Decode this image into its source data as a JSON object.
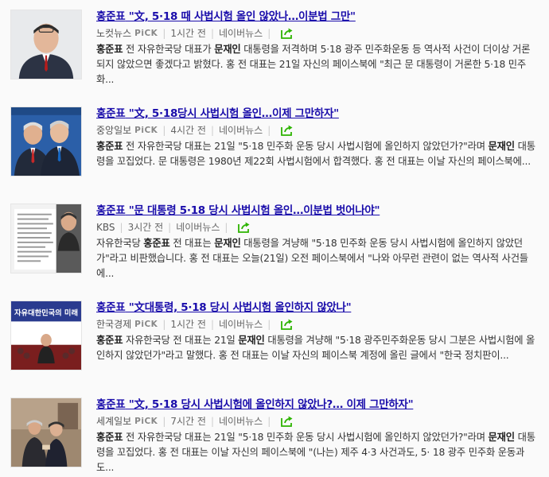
{
  "colors": {
    "link": "#1a0dab",
    "share_icon": "#2db400"
  },
  "results": [
    {
      "title_pre": "홍준표",
      "title_rest": " \"文, 5·18 때 사법시험 올인 않았나…이분법 그만\"",
      "source": "노컷뉴스",
      "pick": "PiCK",
      "time": "1시간 전",
      "portal": "네이버뉴스",
      "thumb": "portrait",
      "desc": [
        {
          "t": "홍준표",
          "b": true
        },
        {
          "t": " 전 자유한국당 대표가 ",
          "b": false
        },
        {
          "t": "문재인",
          "b": true
        },
        {
          "t": " 대통령을 저격하며 5·18 광주 민주화운동 등 역사적 사건이 더이상 거론되지 않았으면 좋겠다고 밝혔다. 홍 전 대표는 21일 자신의 페이스북에 \"최근 문 대통령이 거론한 5·18 민주화...",
          "b": false
        }
      ]
    },
    {
      "title_pre": "홍준표",
      "title_rest": " \"文, 5·18당시 사법시험 올인…이제 그만하자\"",
      "source": "중앙일보",
      "pick": "PiCK",
      "time": "4시간 전",
      "portal": "네이버뉴스",
      "thumb": "two-people",
      "desc": [
        {
          "t": "홍준표",
          "b": true
        },
        {
          "t": " 전 자유한국당 대표는 21일 \"5·18 민주화 운동 당시 사법시험에 올인하지 않았던가?\"라며 ",
          "b": false
        },
        {
          "t": "문재인",
          "b": true
        },
        {
          "t": " 대통령을 꼬집었다. 문 대통령은 1980년 제22회 사법시험에서 합격했다. 홍 전 대표는 이날 자신의 페이스북에...",
          "b": false
        }
      ]
    },
    {
      "title_pre": "홍준표",
      "title_rest": " \"문 대통령 5·18 당시 사법시험 올인…이분법 벗어나야\"",
      "source": "KBS",
      "pick": "",
      "time": "3시간 전",
      "portal": "네이버뉴스",
      "thumb": "document",
      "desc": [
        {
          "t": "자유한국당 ",
          "b": false
        },
        {
          "t": "홍준표",
          "b": true
        },
        {
          "t": " 전 대표는 ",
          "b": false
        },
        {
          "t": "문재인",
          "b": true
        },
        {
          "t": " 대통령을 겨냥해 \"5·18 민주화 운동 당시 사법시험에 올인하지 않았던가\"라고 비판했습니다. 홍 전 대표는 오늘(21일) 오전 페이스북에서 \"나와 아무런 관련이 없는 역사적 사건들에...",
          "b": false
        }
      ]
    },
    {
      "title_pre": "홍준표",
      "title_rest": " \"文대통령, 5·18 당시 사법시험 올인하지 않았나\"",
      "source": "한국경제",
      "pick": "PiCK",
      "time": "1시간 전",
      "portal": "네이버뉴스",
      "thumb": "banner",
      "thumb_text": "자유대한민국의 미래",
      "desc": [
        {
          "t": "홍준표",
          "b": true
        },
        {
          "t": " 자유한국당 전 대표는 21일 ",
          "b": false
        },
        {
          "t": "문재인",
          "b": true
        },
        {
          "t": " 대통령을 겨냥해 \"5·18 광주민주화운동 당시 그분은 사법시험에 올인하지 않았던가\"라고 말했다. 홍 전 대표는 이날 자신의 페이스북 계정에 올린 글에서 \"한국 정치판이...",
          "b": false
        }
      ]
    },
    {
      "title_pre": "홍준표",
      "title_rest": " \"文, 5·18 당시 사법시험에 올인하지 않았나?… 이제 그만하자\"",
      "source": "세계일보",
      "pick": "PiCK",
      "time": "7시간 전",
      "portal": "네이버뉴스",
      "thumb": "meeting",
      "desc": [
        {
          "t": "홍준표",
          "b": true
        },
        {
          "t": " 전 자유한국당 대표는 21일 \"5·18 민주화 운동 당시 사법시험에 올인하지 않았던가?\"라며 ",
          "b": false
        },
        {
          "t": "문재인",
          "b": true
        },
        {
          "t": " 대통령을 꼬집었다. 홍 전 대표는 이날 자신의 페이스북에 \"(나는) 제주 4·3 사건과도, 5· 18 광주 민주화 운동과도...",
          "b": false
        }
      ]
    }
  ]
}
